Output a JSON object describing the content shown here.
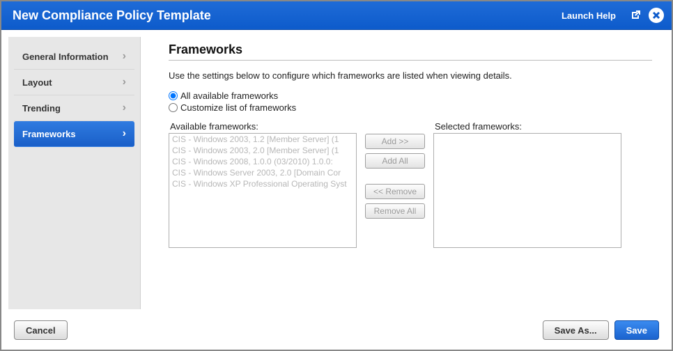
{
  "titlebar": {
    "title": "New Compliance Policy Template",
    "launch_help": "Launch Help"
  },
  "sidebar": {
    "items": [
      {
        "label": "General Information",
        "active": false
      },
      {
        "label": "Layout",
        "active": false
      },
      {
        "label": "Trending",
        "active": false
      },
      {
        "label": "Frameworks",
        "active": true
      }
    ]
  },
  "main": {
    "heading": "Frameworks",
    "description": "Use the settings below to configure which frameworks are listed when viewing details.",
    "radio_all": "All available frameworks",
    "radio_custom": "Customize list of frameworks",
    "available_label": "Available frameworks:",
    "selected_label": "Selected frameworks:",
    "available_items": [
      "CIS - Windows 2003, 1.2 [Member Server] (1",
      "CIS - Windows 2003, 2.0 [Member Server] (1",
      "CIS - Windows 2008, 1.0.0 (03/2010) 1.0.0:",
      "CIS - Windows Server 2003, 2.0 [Domain Cor",
      "CIS - Windows XP Professional Operating Syst"
    ],
    "selected_items": [],
    "btn_add": "Add >>",
    "btn_add_all": "Add All",
    "btn_remove": "<< Remove",
    "btn_remove_all": "Remove All"
  },
  "footer": {
    "cancel": "Cancel",
    "save_as": "Save As...",
    "save": "Save"
  }
}
